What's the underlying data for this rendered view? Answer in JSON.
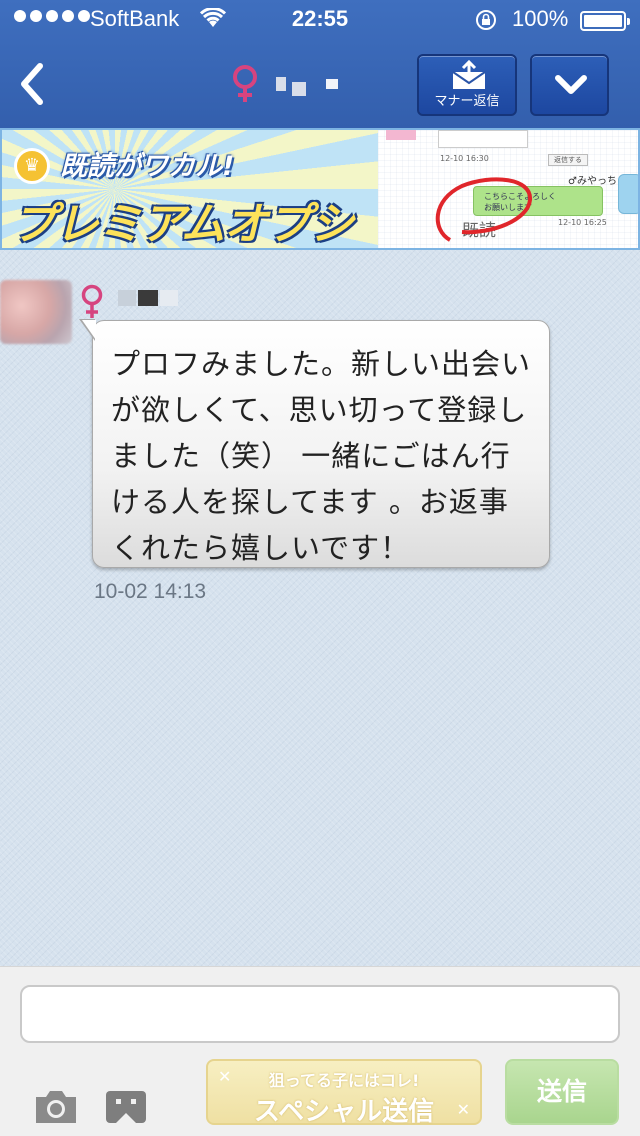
{
  "status_bar": {
    "carrier": "SoftBank",
    "time": "22:55",
    "battery": "100%"
  },
  "nav": {
    "manner_reply_label": "マナー返信"
  },
  "banner": {
    "tagline": "既読がワカル!",
    "headline": "プレミアムオプション",
    "preview": {
      "time1": "12-10 16:30",
      "button": "返信する",
      "name": "♂みやっち",
      "bubble_line1": "こちらこそよろしく",
      "bubble_line2": "お願いします",
      "time2": "12-10 16:25",
      "read_label": "既読"
    }
  },
  "chat": {
    "message": "プロフみました。新しい出会いが欲しくて、思い切って登録しました（笑） 一緒にごはん行ける人を探してます 。お返事くれたら嬉しいです！",
    "timestamp": "10-02 14:13"
  },
  "composer": {
    "input_value": "",
    "special_small": "狙ってる子にはコレ!",
    "special_big": "スペシャル送信",
    "send_label": "送信"
  },
  "colors": {
    "nav_blue": "#3a68b8",
    "female_pink": "#d6447f",
    "send_green": "#a9d58e"
  },
  "icons": [
    "chevron-left-icon",
    "female-icon",
    "mail-upload-icon",
    "chevron-down-icon",
    "camera-icon",
    "stamp-icon",
    "wifi-icon",
    "lock-rotation-icon",
    "battery-icon",
    "crown-icon"
  ]
}
